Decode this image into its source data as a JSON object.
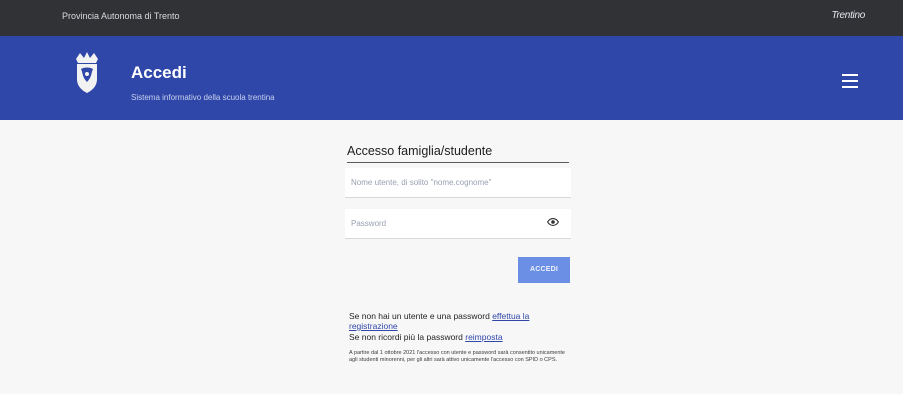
{
  "topbar": {
    "province": "Provincia Autonoma di Trento",
    "brand": "Trentino"
  },
  "header": {
    "title": "Accedi",
    "subtitle": "Sistema informativo della scuola trentina"
  },
  "form": {
    "heading": "Accesso famiglia/studente",
    "username_placeholder": "Nome utente, di solito \"nome.cognome\"",
    "password_placeholder": "Password",
    "login_label": "ACCEDI"
  },
  "info": {
    "register_text": "Se non hai un utente e una password ",
    "register_link": "effettua la registrazione",
    "forgot_text": "Se non ricordi più la password ",
    "forgot_link": "reimposta",
    "notice": "A partire dal 1 ottobre 2021 l'accesso con utente e password sarà consentito unicamente agli studenti minorenni, per gli altri sarà attivo unicamente l'accesso con SPID o CPS."
  }
}
